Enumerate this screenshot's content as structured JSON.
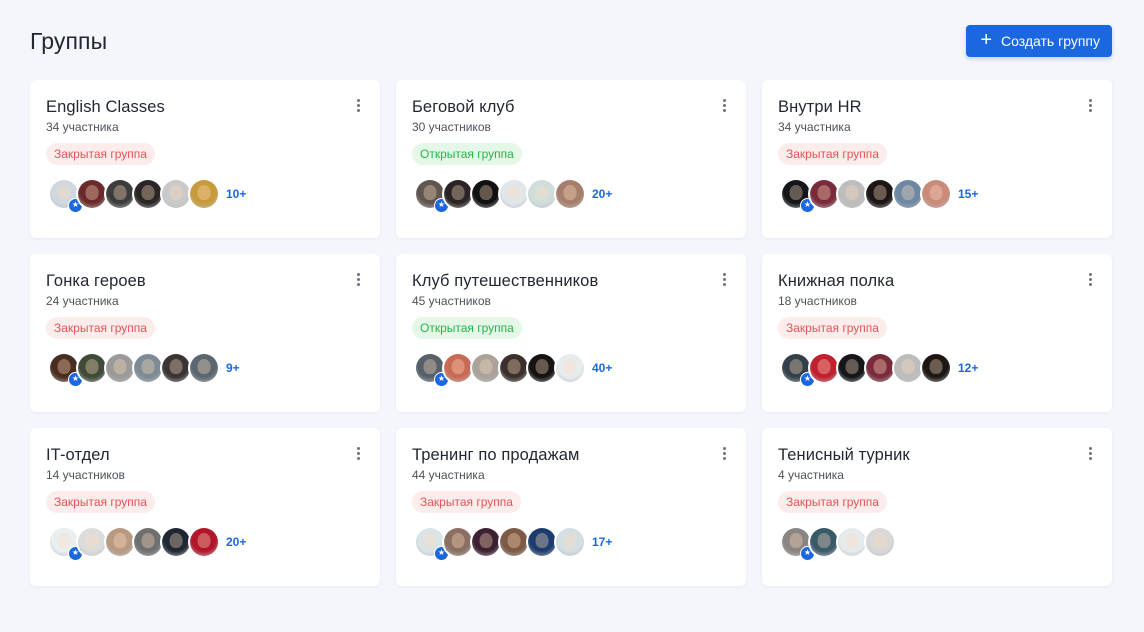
{
  "header": {
    "title": "Группы",
    "create_button": "Создать группу"
  },
  "groups": [
    {
      "name": "English Classes",
      "members": "34 участника",
      "status": "Закрытая группа",
      "type": "closed",
      "more": "10+",
      "avatars": [
        "#cfd8de",
        "#6b2a2a",
        "#3c3c3c",
        "#2a2626",
        "#c9c9c9",
        "#c79a3a"
      ]
    },
    {
      "name": "Беговой клуб",
      "members": "30 участников",
      "status": "Открытая группа",
      "type": "open",
      "more": "20+",
      "avatars": [
        "#5f564f",
        "#2a2424",
        "#111111",
        "#dfe7ea",
        "#cfdedc",
        "#a67f6c"
      ]
    },
    {
      "name": "Внутри HR",
      "members": "34 участника",
      "status": "Закрытая группа",
      "type": "closed",
      "more": "15+",
      "avatars": [
        "#14161a",
        "#7a2b3b",
        "#bdbdbd",
        "#1c1714",
        "#6d88a3",
        "#c98a7a"
      ]
    },
    {
      "name": "Гонка героев",
      "members": "24 участника",
      "status": "Закрытая группа",
      "type": "closed",
      "more": "9+",
      "avatars": [
        "#4a2c21",
        "#3f4a38",
        "#9a9a9a",
        "#7d8b96",
        "#3a3434",
        "#5a6670"
      ]
    },
    {
      "name": "Клуб путешественников",
      "members": "45 участников",
      "status": "Открытая группа",
      "type": "open",
      "more": "40+",
      "avatars": [
        "#566069",
        "#c96a55",
        "#a9a39b",
        "#3b302b",
        "#151313",
        "#e7ecee"
      ]
    },
    {
      "name": "Книжная полка",
      "members": "18 участников",
      "status": "Закрытая группа",
      "type": "closed",
      "more": "12+",
      "avatars": [
        "#33404a",
        "#c21f2f",
        "#14161a",
        "#7a2b3b",
        "#bdbdbd",
        "#1c1714"
      ]
    },
    {
      "name": "IT-отдел",
      "members": "14 участников",
      "status": "Закрытая группа",
      "type": "closed",
      "more": "20+",
      "avatars": [
        "#e9eef0",
        "#dcdcdc",
        "#b89a83",
        "#6f6f6f",
        "#1e2733",
        "#b3152a"
      ]
    },
    {
      "name": "Тренинг по продажам",
      "members": "44 участника",
      "status": "Закрытая группа",
      "type": "closed",
      "more": "17+",
      "avatars": [
        "#d9e4e6",
        "#8a6f62",
        "#3b2132",
        "#7d5a45",
        "#1d3c6e",
        "#d3dfe3"
      ]
    },
    {
      "name": "Тенисный турник",
      "members": "4 участника",
      "status": "Закрытая группа",
      "type": "closed",
      "more": "",
      "avatars": [
        "#8a8582",
        "#3a5a6a",
        "#e5ebed",
        "#d8d8d8"
      ]
    }
  ],
  "colors": {
    "accent": "#1a67e0",
    "closed_badge": "#e05555",
    "open_badge": "#27b24a"
  },
  "icons": {
    "menu": "more-vertical-icon",
    "add": "plus-icon",
    "admin": "star-icon"
  }
}
